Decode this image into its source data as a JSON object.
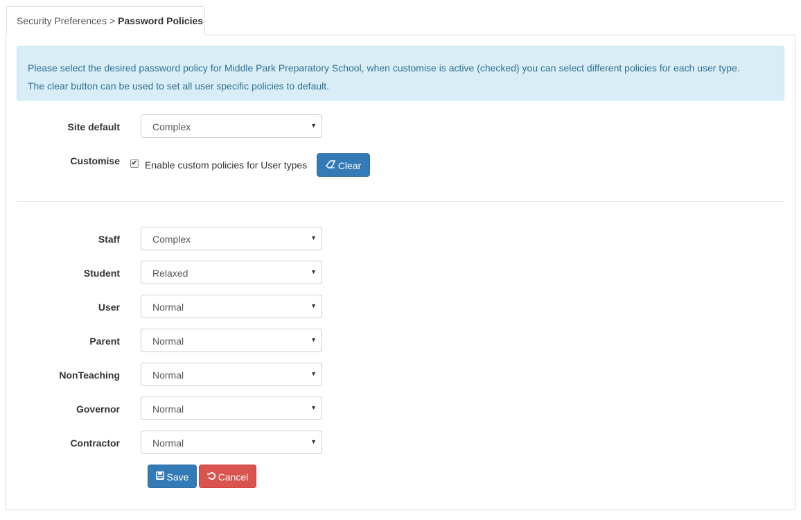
{
  "breadcrumb": {
    "parent": "Security Preferences",
    "separator": ">",
    "current": "Password Policies"
  },
  "info": {
    "line1": "Please select the desired password policy for Middle Park Preparatory School, when customise is active (checked) you can select different policies for each user type.",
    "line2": "The clear button can be used to set all user specific policies to default."
  },
  "site_default": {
    "label": "Site default",
    "value": "Complex"
  },
  "customise": {
    "label": "Customise",
    "checked": true,
    "checkbox_label": "Enable custom policies for User types",
    "clear_label": "Clear"
  },
  "user_types": [
    {
      "label": "Staff",
      "value": "Complex"
    },
    {
      "label": "Student",
      "value": "Relaxed"
    },
    {
      "label": "User",
      "value": "Normal"
    },
    {
      "label": "Parent",
      "value": "Normal"
    },
    {
      "label": "NonTeaching",
      "value": "Normal"
    },
    {
      "label": "Governor",
      "value": "Normal"
    },
    {
      "label": "Contractor",
      "value": "Normal"
    }
  ],
  "actions": {
    "save_label": "Save",
    "cancel_label": "Cancel"
  },
  "icons": {
    "select_caret": "caret-down-icon",
    "clear": "eraser-icon",
    "save": "floppy-disk-icon",
    "cancel": "undo-icon"
  },
  "colors": {
    "primary": "#337ab7",
    "danger": "#d9534f",
    "info_bg": "#d9edf7",
    "info_text": "#31708f"
  }
}
